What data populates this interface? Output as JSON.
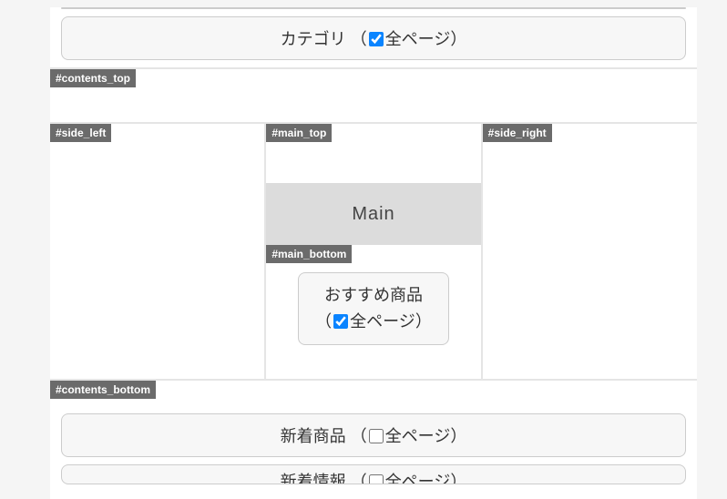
{
  "top_block": {
    "label_before": "カテゴリ",
    "checkbox_label": "全ページ",
    "checked": true
  },
  "regions": {
    "contents_top": "#contents_top",
    "side_left": "#side_left",
    "main_top": "#main_top",
    "main_label": "Main",
    "main_bottom": "#main_bottom",
    "side_right": "#side_right",
    "contents_bottom": "#contents_bottom"
  },
  "recommend_block": {
    "label": "おすすめ商品",
    "checkbox_label": "全ページ",
    "checked": true
  },
  "bottom_blocks": {
    "new_products": {
      "label_before": "新着商品",
      "checkbox_label": "全ページ",
      "checked": false
    },
    "new_info": {
      "label_before": "新着情報",
      "checkbox_label": "全ページ",
      "checked": false
    }
  }
}
